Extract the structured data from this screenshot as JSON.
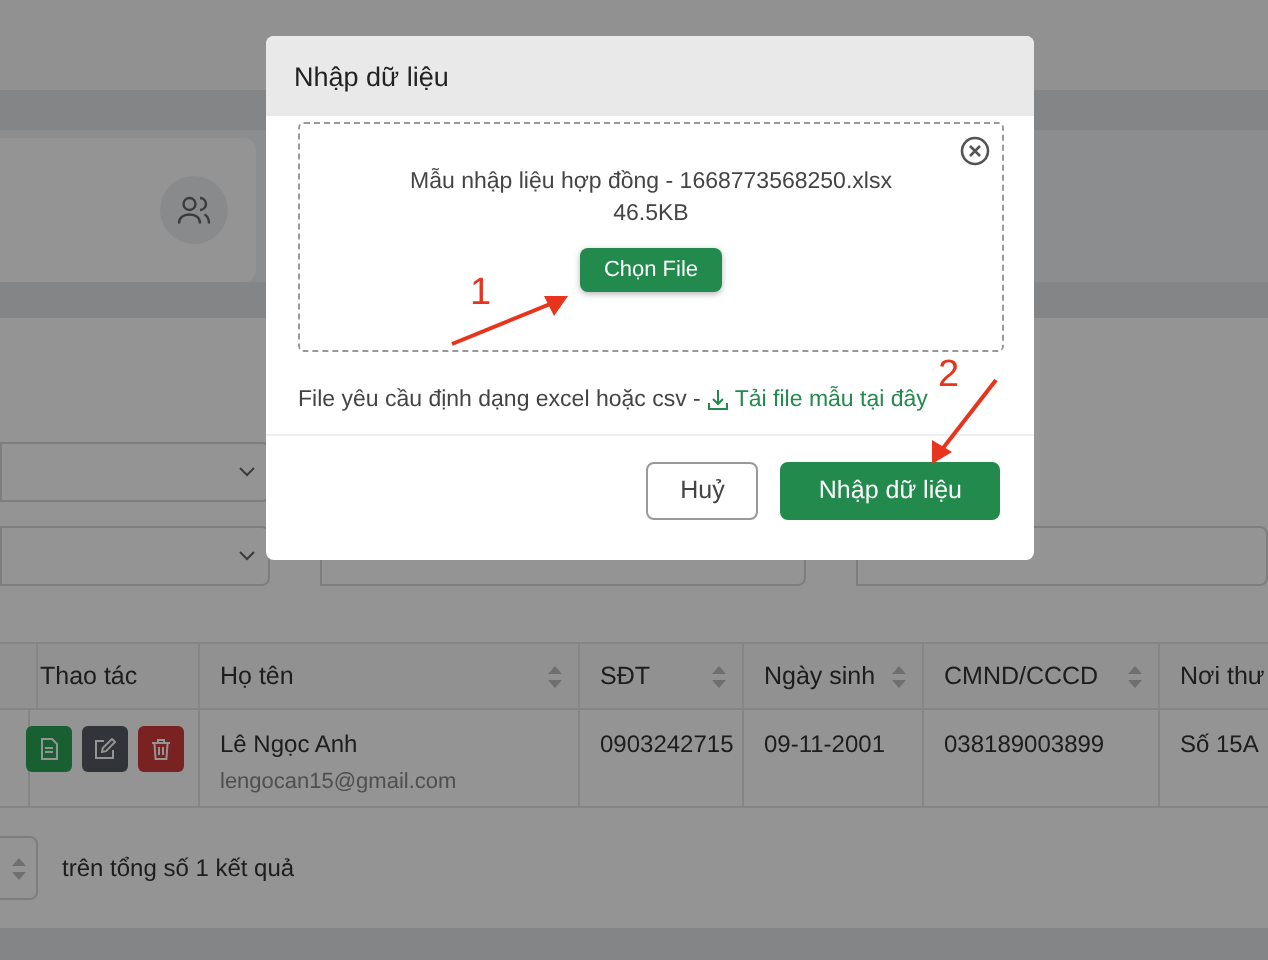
{
  "page": {
    "table": {
      "columns": [
        {
          "label": "Thao tác",
          "sortable": false
        },
        {
          "label": "Họ tên",
          "sortable": true
        },
        {
          "label": "SĐT",
          "sortable": true
        },
        {
          "label": "Ngày sinh",
          "sortable": true
        },
        {
          "label": "CMND/CCCD",
          "sortable": true
        },
        {
          "label": "Nơi thư"
        }
      ],
      "rows": [
        {
          "name": "Lê Ngọc Anh",
          "email": "lengocan15@gmail.com",
          "phone": "0903242715",
          "birth_date": "09-11-2001",
          "id_number": "038189003899",
          "address": "Số 15A"
        }
      ]
    },
    "pagination": {
      "summary": "trên tổng số 1 kết quả"
    }
  },
  "dialog": {
    "title": "Nhập dữ liệu",
    "file_name": "Mẫu nhập liệu hợp đồng - 1668773568250.xlsx",
    "file_size": "46.5KB",
    "choose_button": "Chọn File",
    "hint": "File yêu cầu định dạng excel hoặc csv -",
    "template_link": "Tải file mẫu tại đây",
    "buttons": [
      {
        "label": "Huỷ",
        "kind": "secondary"
      },
      {
        "label": "Nhập dữ liệu",
        "kind": "primary"
      }
    ]
  },
  "annotations": [
    {
      "label": "1"
    },
    {
      "label": "2"
    }
  ]
}
